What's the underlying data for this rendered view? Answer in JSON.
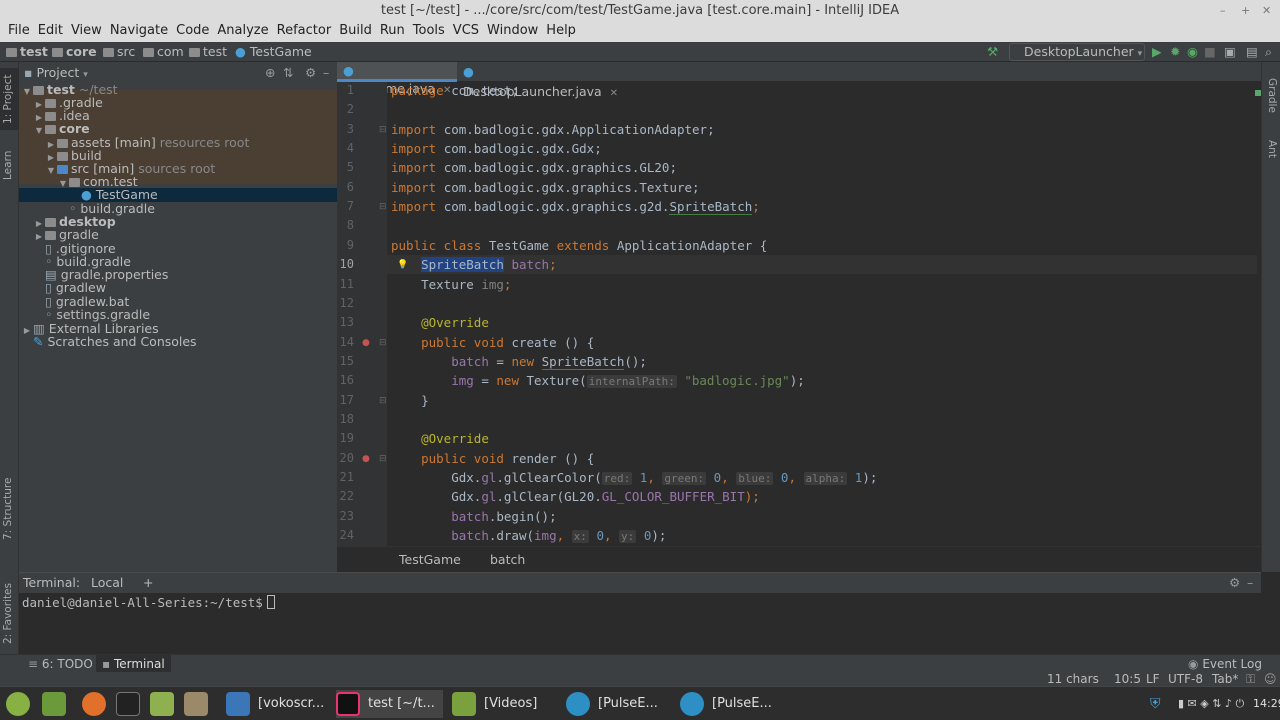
{
  "window": {
    "title": "test [~/test] - .../core/src/com/test/TestGame.java [test.core.main] - IntelliJ IDEA"
  },
  "menu": [
    "File",
    "Edit",
    "View",
    "Navigate",
    "Code",
    "Analyze",
    "Refactor",
    "Build",
    "Run",
    "Tools",
    "VCS",
    "Window",
    "Help"
  ],
  "breadcrumbs": [
    "test",
    "core",
    "src",
    "com",
    "test",
    "TestGame"
  ],
  "run_config": "DesktopLauncher",
  "side_tabs_left": [
    "1: Project",
    "Learn",
    "7: Structure",
    "2: Favorites"
  ],
  "side_tabs_right": [
    "Gradle",
    "Ant"
  ],
  "project_panel": {
    "title": "Project",
    "tree": [
      {
        "label": "test",
        "hint": "~/test",
        "bold": true
      },
      {
        "label": ".gradle"
      },
      {
        "label": ".idea"
      },
      {
        "label": "core",
        "bold": true
      },
      {
        "label": "assets [main]",
        "hint": "resources root"
      },
      {
        "label": "build"
      },
      {
        "label": "src [main]",
        "hint": "sources root"
      },
      {
        "label": "com.test"
      },
      {
        "label": "TestGame"
      },
      {
        "label": "build.gradle"
      },
      {
        "label": "desktop",
        "bold": true
      },
      {
        "label": "gradle"
      },
      {
        "label": ".gitignore"
      },
      {
        "label": "build.gradle"
      },
      {
        "label": "gradle.properties"
      },
      {
        "label": "gradlew"
      },
      {
        "label": "gradlew.bat"
      },
      {
        "label": "settings.gradle"
      },
      {
        "label": "External Libraries"
      },
      {
        "label": "Scratches and Consoles"
      }
    ]
  },
  "editor": {
    "tabs": [
      "TestGame.java",
      "DesktopLauncher.java"
    ],
    "line_numbers": [
      "1",
      "2",
      "3",
      "4",
      "5",
      "6",
      "7",
      "8",
      "9",
      "10",
      "11",
      "12",
      "13",
      "14",
      "15",
      "16",
      "17",
      "18",
      "19",
      "20",
      "21",
      "22",
      "23",
      "24"
    ],
    "current_line": "10",
    "code": {
      "l1": [
        "package",
        "com.test;"
      ],
      "l3": [
        "import",
        "com.badlogic.gdx.ApplicationAdapter;"
      ],
      "l4": [
        "import",
        "com.badlogic.gdx.Gdx;"
      ],
      "l5": [
        "import",
        "com.badlogic.gdx.graphics.GL20;"
      ],
      "l6": [
        "import",
        "com.badlogic.gdx.graphics.Texture;"
      ],
      "l7": [
        "import",
        "com.badlogic.gdx.graphics.g2d.",
        "SpriteBatch",
        ";"
      ],
      "l9": [
        "public class",
        "TestGame",
        "extends",
        "ApplicationAdapter {"
      ],
      "l10": [
        "SpriteBatch",
        "batch",
        ";"
      ],
      "l11": [
        "Texture",
        "img",
        ";"
      ],
      "l13": "@Override",
      "l14": [
        "public void",
        "create",
        "() {"
      ],
      "l15": [
        "batch",
        "=",
        "new",
        "SpriteBatch",
        "();"
      ],
      "l16": [
        "img",
        "=",
        "new",
        "Texture(",
        "internalPath:",
        "\"badlogic.jpg\"",
        ");"
      ],
      "l17": "}",
      "l19": "@Override",
      "l20": [
        "public void",
        "render",
        "() {"
      ],
      "l21": [
        "Gdx.",
        "gl",
        ".glClearColor(",
        "red:",
        "1",
        ",",
        "green:",
        "0",
        ",",
        "blue:",
        "0",
        ",",
        "alpha:",
        "1",
        ");"
      ],
      "l22": [
        "Gdx.",
        "gl",
        ".glClear(GL20.",
        "GL_COLOR_BUFFER_BIT",
        ");"
      ],
      "l23": [
        "batch",
        ".begin();"
      ],
      "l24": [
        "batch",
        ".draw(",
        "img",
        ",",
        "x:",
        "0",
        ",",
        "y:",
        "0",
        ");"
      ]
    },
    "breadcrumb": [
      "TestGame",
      "batch"
    ]
  },
  "terminal": {
    "label": "Terminal:",
    "tab": "Local",
    "add": "+",
    "prompt": "daniel@daniel-All-Series:~/test$"
  },
  "tool_windows": [
    "6: TODO",
    "Terminal"
  ],
  "event_log": "Event Log",
  "status": {
    "chars": "11 chars",
    "position": "10:5",
    "line_sep": "LF",
    "encoding": "UTF-8",
    "indent": "Tab*"
  },
  "taskbar": {
    "items": [
      "[vokoscr...",
      "test [~/t...",
      "[Videos]",
      "[PulseE...",
      "[PulseE..."
    ],
    "clock": "14:29"
  }
}
